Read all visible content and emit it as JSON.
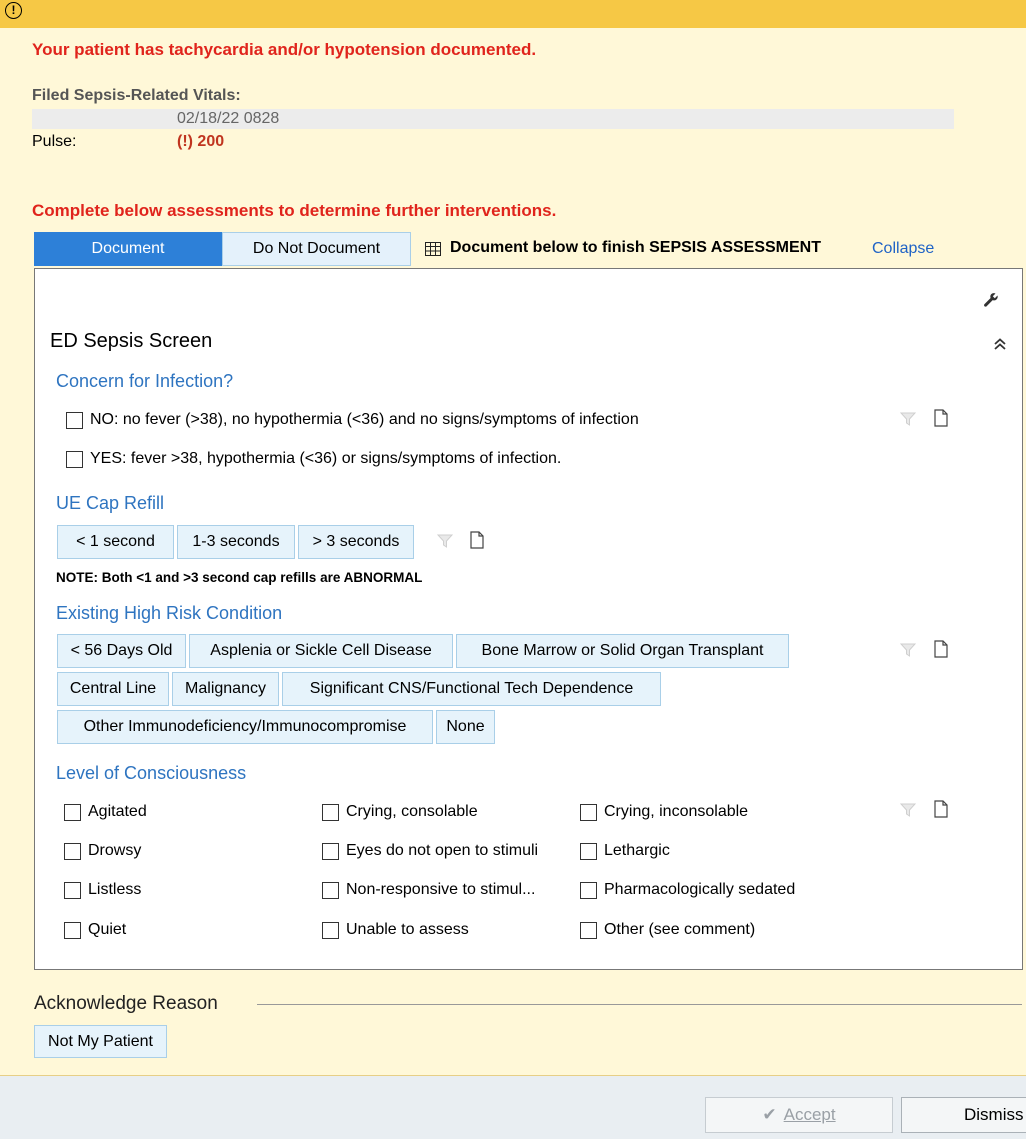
{
  "alert": {
    "message": "Your patient has tachycardia and/or hypotension documented.",
    "vitals_heading": "Filed Sepsis-Related Vitals:",
    "vitals_datetime": "02/18/22 0828",
    "pulse_label": "Pulse:",
    "pulse_value": "(!) 200",
    "instruction": "Complete below assessments to determine further interventions."
  },
  "toggle": {
    "document_label": "Document",
    "do_not_document_label": "Do Not Document",
    "selected": "Document"
  },
  "finish_text": "Document below to finish SEPSIS ASSESSMENT",
  "collapse_label": "Collapse",
  "form": {
    "title": "ED Sepsis Screen",
    "infection": {
      "heading": "Concern for Infection?",
      "options": [
        "NO: no fever (>38), no hypothermia (<36) and no signs/symptoms of infection",
        "YES: fever >38, hypothermia (<36) or signs/symptoms of infection."
      ]
    },
    "cap_refill": {
      "heading": "UE Cap Refill",
      "options": [
        "< 1 second",
        "1-3 seconds",
        "> 3 seconds"
      ],
      "note": "NOTE: Both <1 and >3 second cap refills are ABNORMAL"
    },
    "high_risk": {
      "heading": "Existing High Risk Condition",
      "options": [
        "< 56 Days Old",
        "Asplenia or Sickle Cell Disease",
        "Bone Marrow or Solid Organ Transplant",
        "Central Line",
        "Malignancy",
        "Significant CNS/Functional Tech Dependence",
        "Other Immunodeficiency/Immunocompromise",
        "None"
      ]
    },
    "consciousness": {
      "heading": "Level of Consciousness",
      "options": [
        "Agitated",
        "Crying, consolable",
        "Crying, inconsolable",
        "Drowsy",
        "Eyes do not open to stimuli",
        "Lethargic",
        "Listless",
        "Non-responsive to stimul...",
        "Pharmacologically sedated",
        "Quiet",
        "Unable to assess",
        "Other (see comment)"
      ]
    }
  },
  "acknowledge": {
    "heading": "Acknowledge Reason",
    "options": [
      "Not My Patient"
    ]
  },
  "footer": {
    "accept_label": "Accept",
    "dismiss_label": "Dismiss"
  },
  "colors": {
    "alert_red": "#e0241c",
    "header_bar": "#f6c845",
    "section_blue": "#2e74c0",
    "selected_blue": "#2d80d8",
    "background": "#fff8d8"
  }
}
